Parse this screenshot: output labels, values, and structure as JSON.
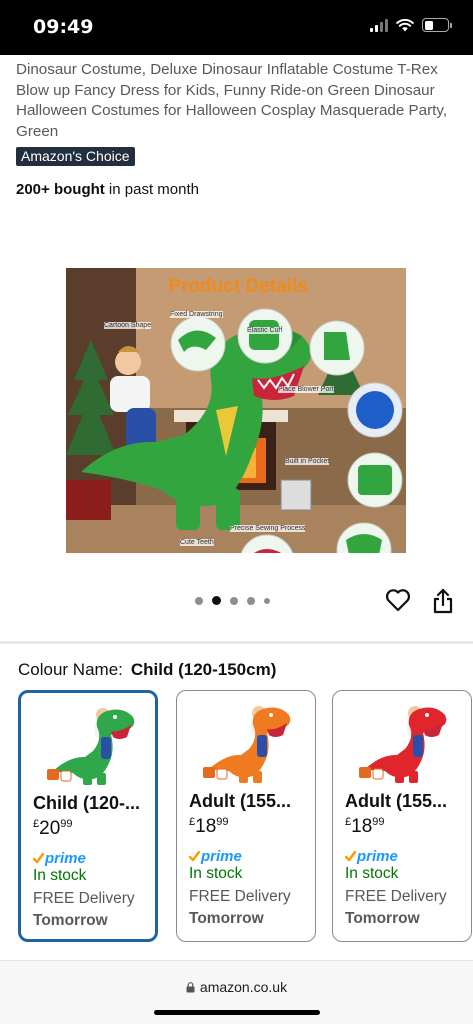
{
  "status_bar": {
    "time": "09:49",
    "battery_level": 0.4
  },
  "product": {
    "title": "Dinosaur Costume, Deluxe Dinosaur Inflatable Costume T-Rex Blow up Fancy Dress for Kids, Funny Ride-on Green Dinosaur Halloween Costumes for Halloween Cosplay Masquerade Party, Green",
    "badge": "Amazon's Choice",
    "bought_count": "200+ bought",
    "bought_suffix": " in past month"
  },
  "image_gallery": {
    "heading": "Product Details",
    "callouts": [
      "Cartoon Shape",
      "Fixed Drawstring",
      "Elastic Cuff",
      "Place Blower Port",
      "Built in Pocket",
      "Precise Sewing Process",
      "Cute Teeth"
    ],
    "dot_count": 5,
    "active_index": 1
  },
  "colour": {
    "label": "Colour Name:",
    "selected": "Child (120-150cm)"
  },
  "swatches": [
    {
      "name": "Child (120-...",
      "currency": "£",
      "whole": "20",
      "fraction": "99",
      "prime": "prime",
      "stock": "In stock",
      "delivery": "FREE Delivery",
      "when": "Tomorrow",
      "color": "#2fa74a"
    },
    {
      "name": "Adult (155...",
      "currency": "£",
      "whole": "18",
      "fraction": "99",
      "prime": "prime",
      "stock": "In stock",
      "delivery": "FREE Delivery",
      "when": "Tomorrow",
      "color": "#f07a1f"
    },
    {
      "name": "Adult (155...",
      "currency": "£",
      "whole": "18",
      "fraction": "99",
      "prime": "prime",
      "stock": "In stock",
      "delivery": "FREE Delivery",
      "when": "Tomorrow",
      "color": "#e0262c"
    }
  ],
  "browser": {
    "url": "amazon.co.uk"
  },
  "colors": {
    "accent_blue": "#2162a1",
    "prime_blue": "#1a98ff",
    "prime_check": "#ff9900",
    "in_stock": "#007600",
    "heading_orange": "#f08a1a"
  }
}
